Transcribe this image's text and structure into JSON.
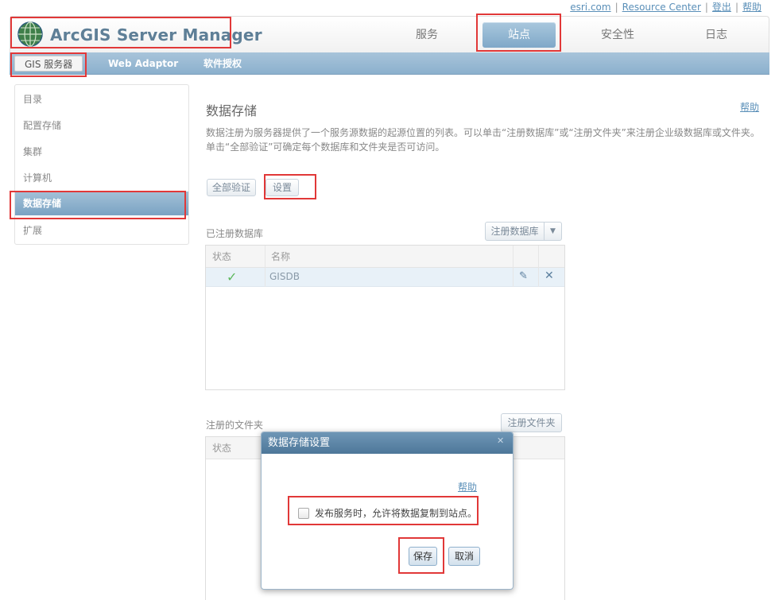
{
  "top_links": {
    "esri": "esri.com",
    "resource_center": "Resource Center",
    "logout": "登出",
    "help": "帮助",
    "separator": "|"
  },
  "app": {
    "title": "ArcGIS Server Manager"
  },
  "top_nav": {
    "services": "服务",
    "site": "站点",
    "security": "安全性",
    "logs": "日志"
  },
  "sub_nav": {
    "gis_server": "GIS 服务器",
    "web_adaptor": "Web Adaptor",
    "licensing": "软件授权"
  },
  "sidebar": {
    "items": [
      {
        "label": "目录"
      },
      {
        "label": "配置存储"
      },
      {
        "label": "集群"
      },
      {
        "label": "计算机"
      },
      {
        "label": "数据存储"
      },
      {
        "label": "扩展"
      }
    ]
  },
  "main": {
    "title": "数据存储",
    "help": "帮助",
    "description_line1": "数据注册为服务器提供了一个服务源数据的起源位置的列表。可以单击“注册数据库”或“注册文件夹”来注册企业级数据库或文件夹。",
    "description_line2": "单击“全部验证”可确定每个数据库和文件夹是否可访问。",
    "validate_all": "全部验证",
    "settings": "设置"
  },
  "databases": {
    "label": "已注册数据库",
    "register_button": "注册数据库",
    "columns": {
      "status": "状态",
      "name": "名称"
    },
    "rows": [
      {
        "status_icon": "check-icon",
        "name": "GISDB"
      }
    ]
  },
  "folders": {
    "label": "注册的文件夹",
    "register_button": "注册文件夹",
    "columns": {
      "status": "状态"
    }
  },
  "dialog": {
    "title": "数据存储设置",
    "help": "帮助",
    "checkbox_label": "发布服务时，允许将数据复制到站点。",
    "checkbox_checked": false,
    "save": "保存",
    "cancel": "取消"
  },
  "colors": {
    "highlight": "#e13838",
    "accent": "#7fa8c8",
    "check": "#5cb85c"
  }
}
